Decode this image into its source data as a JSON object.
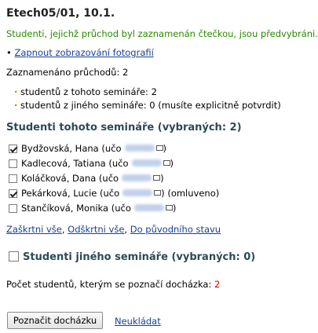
{
  "page": {
    "title": "Etech05/01, 10.1.",
    "info_message": "Studenti, jejichž průchod byl zaznamenán čtečkou, jsou předvybráni.",
    "photo_toggle_label": "Zapnout zobrazování fotografií",
    "recorded_label": "Zaznamenáno průchodů:",
    "recorded_count": "2",
    "recorded_items": [
      "studentů z tohoto semináře: 2",
      "studentů z jiného semináře: 0 (musíte explicitně potvrdit)"
    ]
  },
  "this_seminar": {
    "heading": "Studenti tohoto semináře (vybraných: 2)",
    "students": [
      {
        "name": "Bydžovská, Hana",
        "uco_label": "(učo",
        "checked": true,
        "note": ""
      },
      {
        "name": "Kadlecová, Tatiana",
        "uco_label": "(učo",
        "checked": false,
        "note": ""
      },
      {
        "name": "Koláčková, Dana",
        "uco_label": "(učo",
        "checked": false,
        "note": ""
      },
      {
        "name": "Pekárková, Lucie",
        "uco_label": "(učo",
        "checked": true,
        "note": "(omluveno)"
      },
      {
        "name": "Stančíková, Monika",
        "uco_label": "(učo",
        "checked": false,
        "note": ""
      }
    ],
    "actions": {
      "check_all": "Zaškrtni vše",
      "uncheck_all": "Odškrtni vše",
      "reset": "Do původního stavu"
    }
  },
  "other_seminar": {
    "heading": "Studenti jiného semináře (vybraných: 0)",
    "checked": false
  },
  "summary": {
    "label": "Počet studentů, kterým se poznačí docházka:",
    "count": "2"
  },
  "footer": {
    "submit_label": "Poznačit docházku",
    "cancel_label": "Neukládat"
  }
}
